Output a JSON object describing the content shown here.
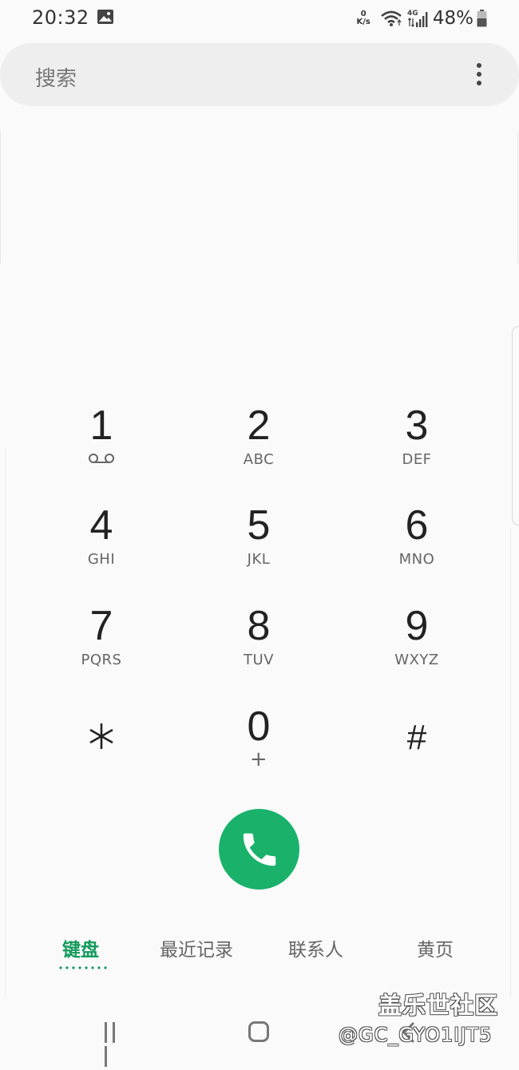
{
  "status_bar": {
    "time": "20:32",
    "net_speed_value": "0",
    "net_speed_unit": "K/s",
    "network_type": "4G",
    "battery": "48%"
  },
  "search": {
    "placeholder": "搜索"
  },
  "keypad": [
    {
      "num": "1",
      "sub": ""
    },
    {
      "num": "2",
      "sub": "ABC"
    },
    {
      "num": "3",
      "sub": "DEF"
    },
    {
      "num": "4",
      "sub": "GHI"
    },
    {
      "num": "5",
      "sub": "JKL"
    },
    {
      "num": "6",
      "sub": "MNO"
    },
    {
      "num": "7",
      "sub": "PQRS"
    },
    {
      "num": "8",
      "sub": "TUV"
    },
    {
      "num": "9",
      "sub": "WXYZ"
    },
    {
      "num": "⁎",
      "sub": ""
    },
    {
      "num": "0",
      "sub": "+"
    },
    {
      "num": "#",
      "sub": ""
    }
  ],
  "tabs": [
    {
      "label": "键盘",
      "active": true
    },
    {
      "label": "最近记录",
      "active": false
    },
    {
      "label": "联系人",
      "active": false
    },
    {
      "label": "黄页",
      "active": false
    }
  ],
  "accent_color": "#1ab26b",
  "watermark": {
    "line1": "盖乐世社区",
    "line2": "@GC_GYO1IJT5"
  }
}
